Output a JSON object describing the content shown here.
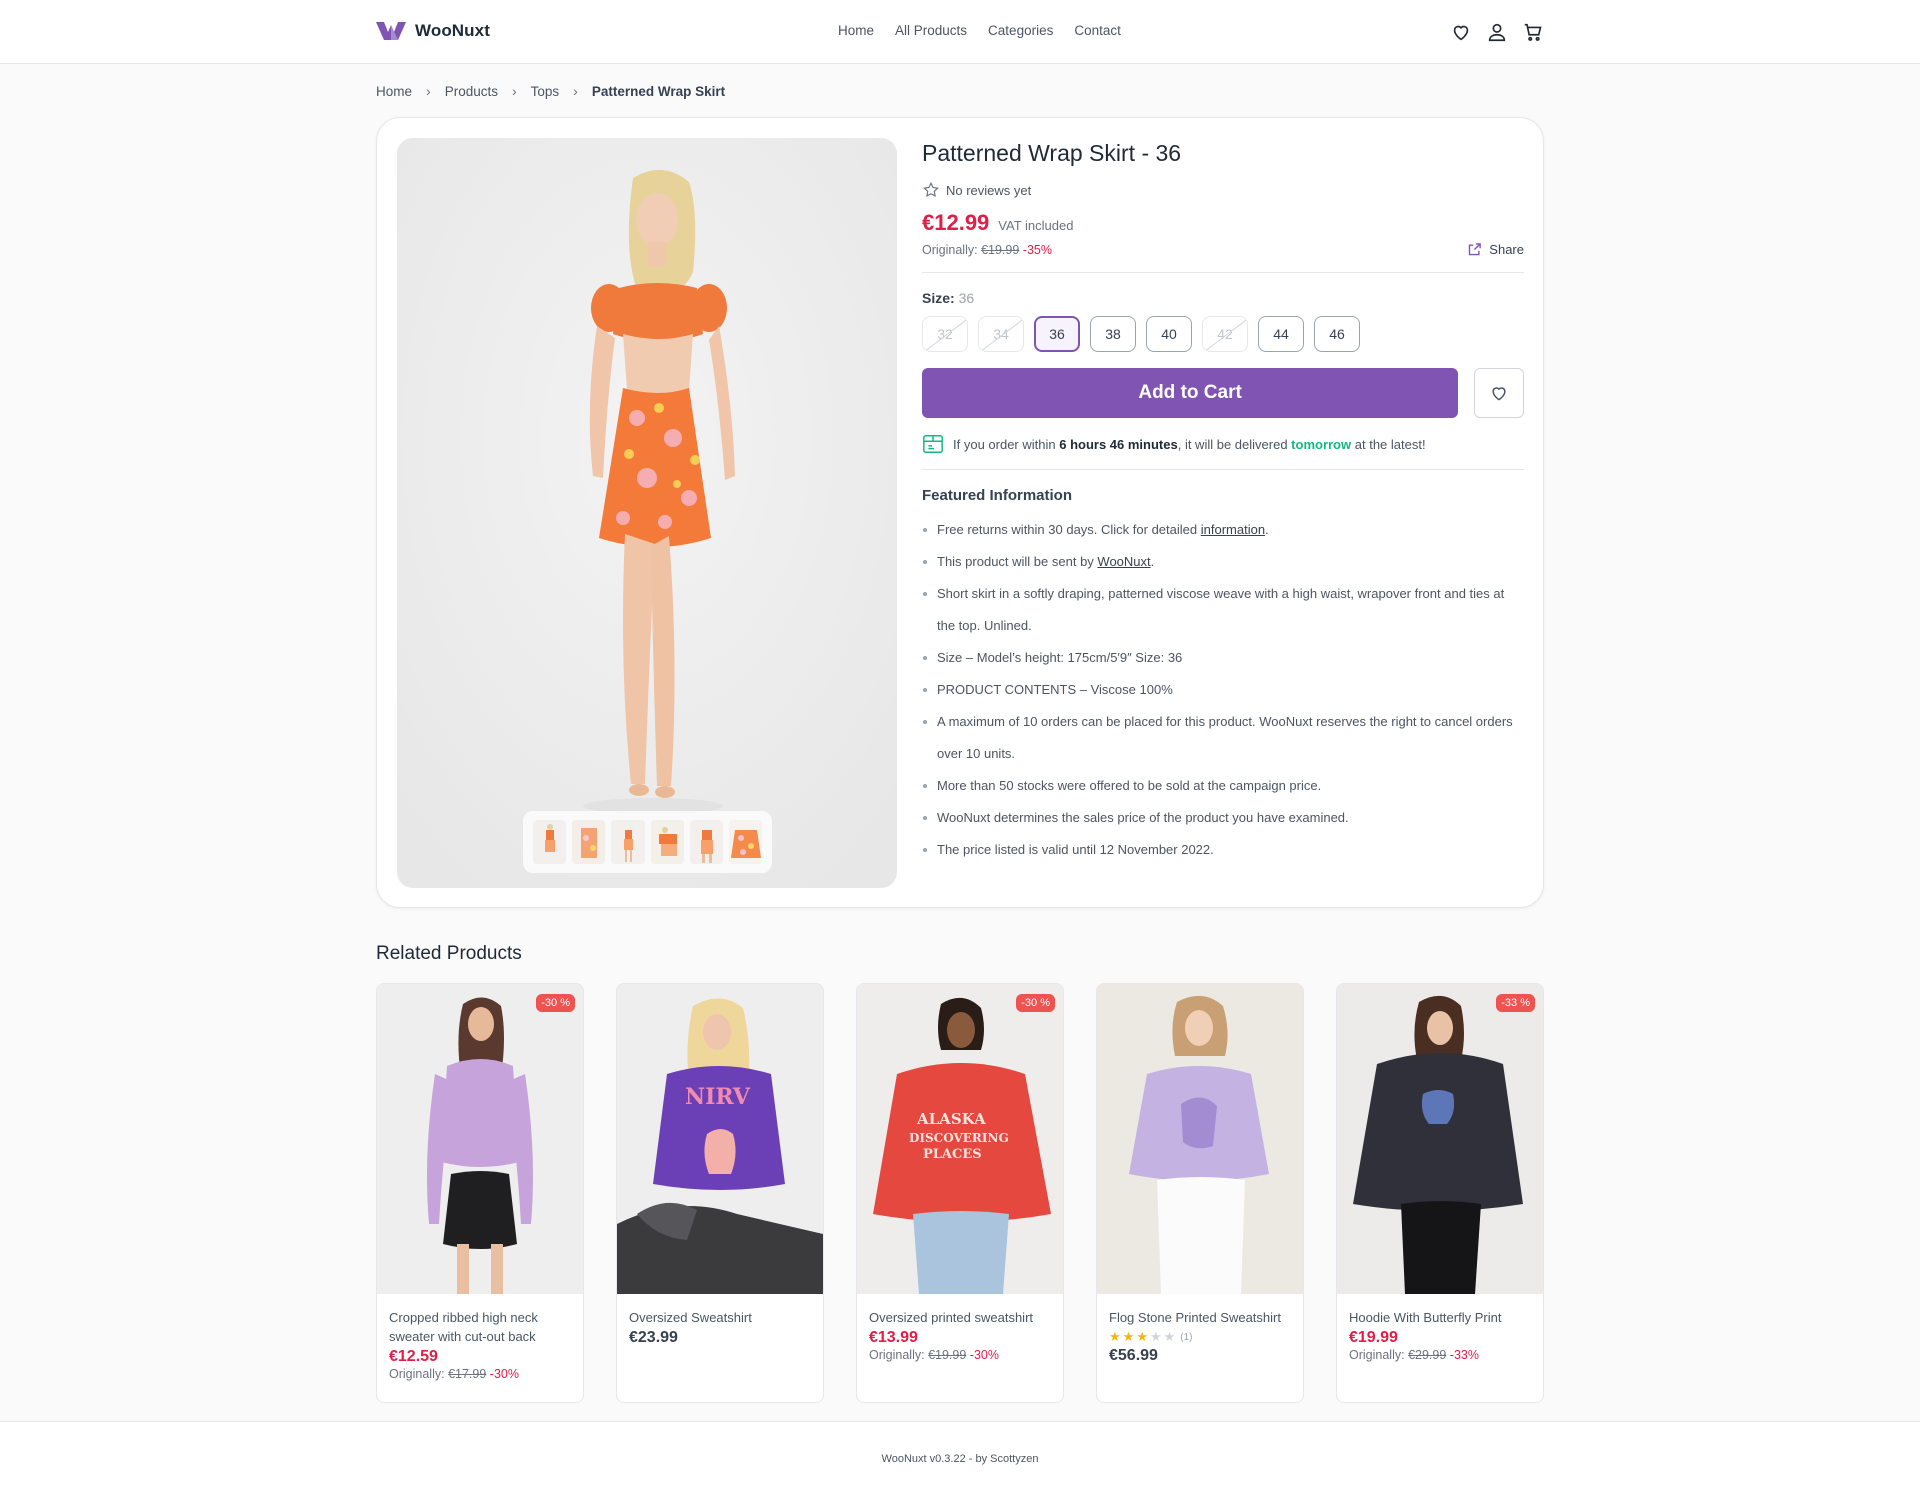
{
  "header": {
    "brand": "WooNuxt",
    "nav": [
      "Home",
      "All Products",
      "Categories",
      "Contact"
    ],
    "icons": [
      "heart-icon",
      "user-icon",
      "cart-icon"
    ]
  },
  "breadcrumb": [
    "Home",
    "Products",
    "Tops",
    "Patterned Wrap Skirt"
  ],
  "product": {
    "title": "Patterned Wrap Skirt - 36",
    "reviews": "No reviews yet",
    "price": "€12.99",
    "vat": "VAT included",
    "original_label": "Originally:",
    "original_price": "€19.99",
    "discount": "-35%",
    "share": "Share",
    "size_label": "Size:",
    "size_selected": "36",
    "sizes": [
      {
        "label": "32",
        "state": "disabled"
      },
      {
        "label": "34",
        "state": "disabled"
      },
      {
        "label": "36",
        "state": "selected"
      },
      {
        "label": "38",
        "state": "available"
      },
      {
        "label": "40",
        "state": "available"
      },
      {
        "label": "42",
        "state": "disabled"
      },
      {
        "label": "44",
        "state": "available"
      },
      {
        "label": "46",
        "state": "available"
      }
    ],
    "add_to_cart": "Add to Cart",
    "delivery": {
      "prefix": "If you order within",
      "time": "6 hours 46 minutes",
      "middle": ", it will be delivered",
      "when": "tomorrow",
      "suffix": "at the latest!"
    },
    "featured_title": "Featured Information",
    "featured": [
      {
        "text": "Free returns within 30 days. Click for detailed ",
        "link": "information",
        "after": "."
      },
      {
        "text": "This product will be sent by ",
        "link": "WooNuxt",
        "after": "."
      },
      {
        "text": "Short skirt in a softly draping, patterned viscose weave with a high waist, wrapover front and ties at the top. Unlined."
      },
      {
        "text": "Size – Model’s height: 175cm/5′9″ Size: 36"
      },
      {
        "text": "PRODUCT CONTENTS – Viscose 100%"
      },
      {
        "text": "A maximum of 10 orders can be placed for this product. WooNuxt reserves the right to cancel orders over 10 units."
      },
      {
        "text": "More than 50 stocks were offered to be sold at the campaign price."
      },
      {
        "text": "WooNuxt determines the sales price of the product you have examined."
      },
      {
        "text": "The price listed is valid until 12 November 2022."
      }
    ]
  },
  "related": {
    "title": "Related Products",
    "items": [
      {
        "name": "Cropped ribbed high neck sweater with cut-out back",
        "price": "€12.59",
        "sale": true,
        "badge": "-30 %",
        "original_label": "Originally:",
        "original": "€17.99",
        "discount": "-30%"
      },
      {
        "name": "Oversized Sweatshirt",
        "price": "€23.99",
        "sale": false
      },
      {
        "name": "Oversized printed sweatshirt",
        "price": "€13.99",
        "sale": true,
        "badge": "-30 %",
        "original_label": "Originally:",
        "original": "€19.99",
        "discount": "-30%"
      },
      {
        "name": "Flog Stone Printed Sweatshirt",
        "price": "€56.99",
        "sale": false,
        "rating": 3,
        "rating_count": "(1)"
      },
      {
        "name": "Hoodie With Butterfly Print",
        "price": "€19.99",
        "sale": true,
        "badge": "-33 %",
        "original_label": "Originally:",
        "original": "€29.99",
        "discount": "-33%"
      }
    ]
  },
  "footer": {
    "text": "WooNuxt v0.3.22 - by Scottyzen"
  },
  "colors": {
    "accent": "#7f54b3",
    "sale": "#e11d48",
    "green": "#10b981",
    "badge": "#ef5350"
  }
}
